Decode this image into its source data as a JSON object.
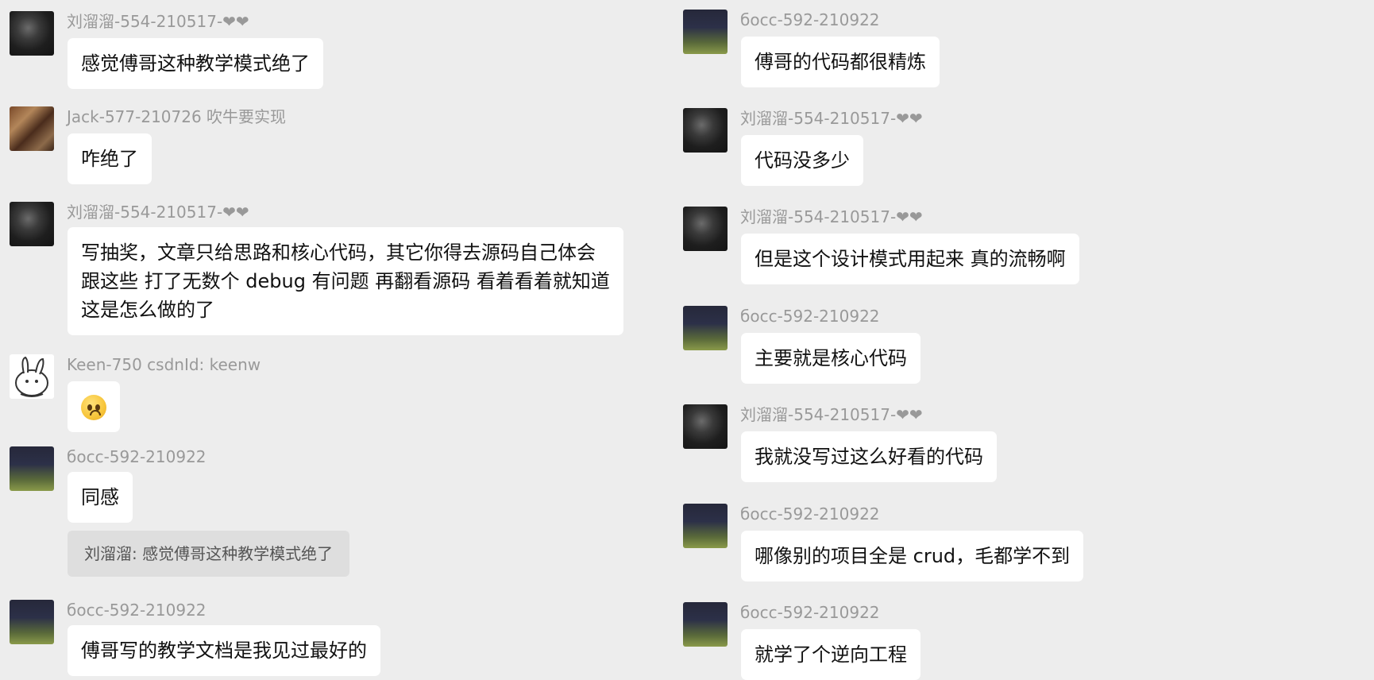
{
  "left_column": {
    "messages": [
      {
        "sender": "刘溜溜-554-210517-❤❤",
        "lines": [
          "感觉傅哥这种教学模式绝了"
        ]
      },
      {
        "sender": "Jack-577-210726 吹牛要实现",
        "lines": [
          "咋绝了"
        ]
      },
      {
        "sender": "刘溜溜-554-210517-❤❤",
        "lines": [
          "写抽奖，文章只给思路和核心代码，其它你得去源码自己体会",
          "跟这些 打了无数个 debug 有问题 再翻看源码 看着看着就知道",
          "这是怎么做的了"
        ]
      },
      {
        "sender": "Keen-750 csdnId: keenw",
        "emoji": "pleading-face"
      },
      {
        "sender": "босс-592-210922",
        "lines": [
          "同感"
        ],
        "quote": "刘溜溜: 感觉傅哥这种教学模式绝了"
      },
      {
        "sender": "босс-592-210922",
        "lines": [
          "傅哥写的教学文档是我见过最好的"
        ]
      }
    ]
  },
  "right_column": {
    "messages": [
      {
        "sender": "босс-592-210922",
        "lines": [
          "傅哥的代码都很精炼"
        ]
      },
      {
        "sender": "刘溜溜-554-210517-❤❤",
        "lines": [
          "代码没多少"
        ]
      },
      {
        "sender": "刘溜溜-554-210517-❤❤",
        "lines": [
          "但是这个设计模式用起来 真的流畅啊"
        ]
      },
      {
        "sender": "босс-592-210922",
        "lines": [
          "主要就是核心代码"
        ]
      },
      {
        "sender": "刘溜溜-554-210517-❤❤",
        "lines": [
          "我就没写过这么好看的代码"
        ]
      },
      {
        "sender": "босс-592-210922",
        "lines": [
          "哪像别的项目全是 crud，毛都学不到"
        ]
      },
      {
        "sender": "босс-592-210922",
        "lines": [
          "就学了个逆向工程"
        ]
      }
    ]
  }
}
